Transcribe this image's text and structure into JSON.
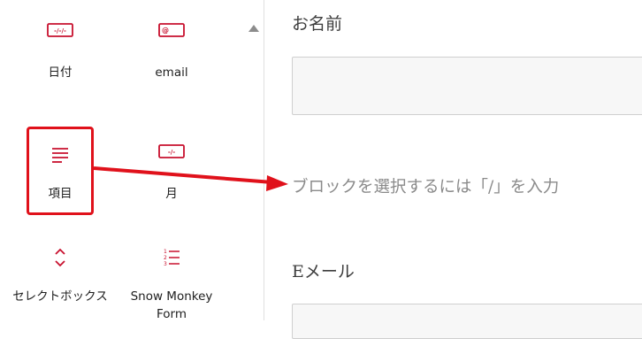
{
  "sidebar": {
    "blocks": [
      {
        "label": "日付",
        "icon": "date-field-icon",
        "icon_text": "-/-/-"
      },
      {
        "label": "email",
        "icon": "email-field-icon",
        "icon_text": "@"
      },
      {
        "label": "項目",
        "icon": "item-paragraph-icon"
      },
      {
        "label": "月",
        "icon": "month-field-icon",
        "icon_text": "-/-"
      },
      {
        "label": "セレクトボックス",
        "icon": "select-box-icon"
      },
      {
        "label": "Snow Monkey Form",
        "icon": "numbered-list-icon"
      }
    ]
  },
  "editor": {
    "name_label": "お名前",
    "block_placeholder": "ブロックを選択するには「/」を入力",
    "email_label": "Eメール"
  },
  "colors": {
    "accent": "#c8102e",
    "highlight": "#e0111b"
  }
}
